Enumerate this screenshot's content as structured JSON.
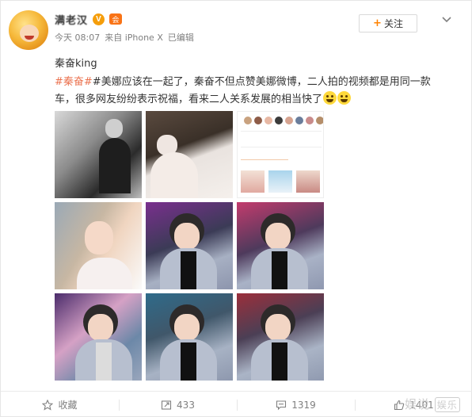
{
  "user": {
    "name": "满老汉",
    "verified_badge": "V",
    "vip_badge": "会",
    "avatar_icon": "cartoon-avatar"
  },
  "meta": {
    "time": "今天 08:07",
    "source": "来自 iPhone X",
    "edited": "已编辑"
  },
  "actions_top": {
    "follow_plus": "+",
    "follow_label": "关注",
    "menu_icon": "chevron-down-icon"
  },
  "post": {
    "title": "秦奋king",
    "hashtag": "#秦奋#",
    "text": "#美娜应该在一起了，秦奋不但点赞美娜微博，二人拍的视频都是用同一款车，很多网友纷纷表示祝福，看来二人关系发展的相当快了"
  },
  "images": [
    {
      "name": "photo-1"
    },
    {
      "name": "photo-2"
    },
    {
      "name": "photo-3"
    },
    {
      "name": "photo-4"
    },
    {
      "name": "photo-5"
    },
    {
      "name": "photo-6"
    },
    {
      "name": "photo-7"
    },
    {
      "name": "photo-8"
    },
    {
      "name": "photo-9"
    }
  ],
  "action_bar": {
    "favorite_label": "收藏",
    "repost_count": "433",
    "comment_count": "1319",
    "like_count": "1401"
  },
  "watermark": {
    "text": "娱说",
    "box": "娱乐"
  },
  "colors": {
    "accent": "#ff8200",
    "hashtag": "#eb7350",
    "meta": "#808080"
  }
}
